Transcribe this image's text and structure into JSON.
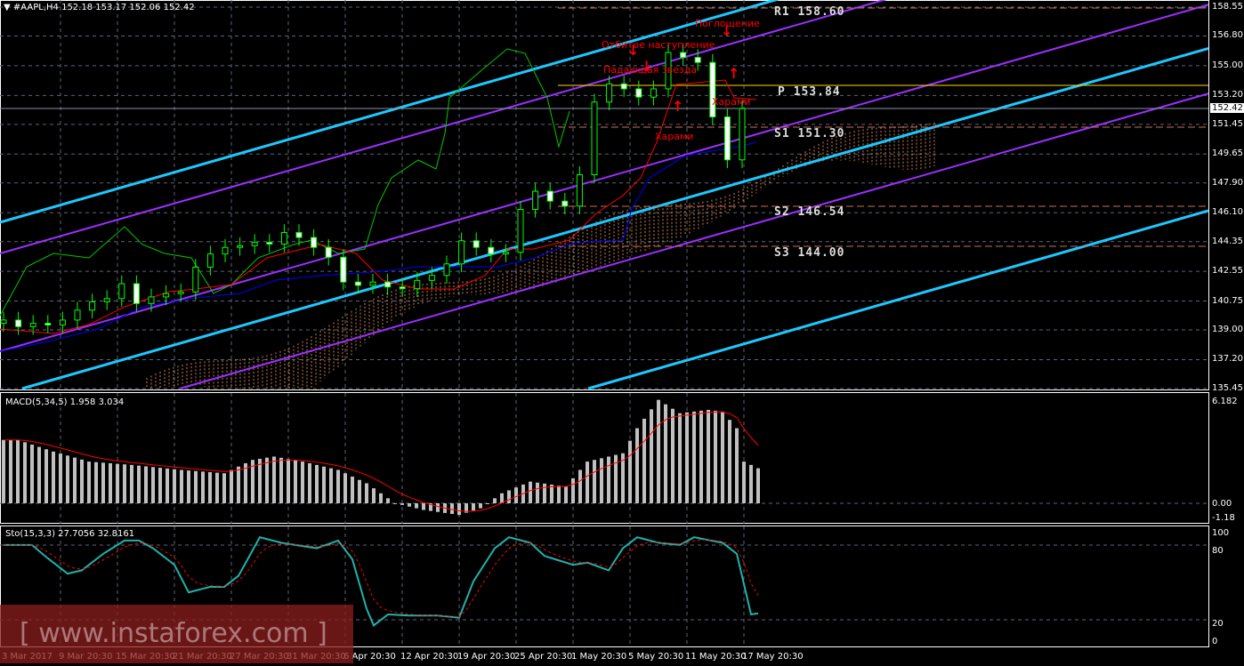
{
  "header": {
    "symbol": "#AAPL,H4",
    "ohlc": "152.18 153.17 152.06 152.42"
  },
  "colors": {
    "bull": "#00ff00",
    "channel_cyan": "#1ec8ff",
    "channel_purple": "#9b30ff",
    "pivot": "#ffd700",
    "tenkan": "#ff0000",
    "kijun": "#0000ff",
    "chikou": "#00c800",
    "cloud": "#ffa060"
  },
  "pivots": {
    "r1": "R1 158.60",
    "p": "P 153.84",
    "s1": "S1 151.30",
    "s2": "S2 146.54",
    "s3": "S3 144.00"
  },
  "annotations": {
    "engulfing": "Поглощение",
    "repelled": "Отбитое наступление",
    "shooting_star": "Падающая звезда",
    "harami1": "Харами",
    "harami2": "Харами"
  },
  "price_axis": [
    "158.55",
    "156.80",
    "155.00",
    "153.20",
    "151.45",
    "149.65",
    "147.90",
    "146.10",
    "144.35",
    "142.55",
    "140.75",
    "139.00",
    "137.20",
    "135.45"
  ],
  "current_price": "152.42",
  "macd": {
    "label": "MACD(5,34,5) 1.958 3.034",
    "axis": [
      "6.182",
      "0.00",
      "-1.18"
    ]
  },
  "sto": {
    "label": "Sto(15,3,3) 27.7056 32.8161",
    "axis": [
      "100",
      "80",
      "20",
      "0"
    ]
  },
  "dates": [
    "3 Mar 2017",
    "9 Mar 20:30",
    "15 Mar 20:30",
    "21 Mar 20:30",
    "27 Mar 20:30",
    "31 Mar 20:30",
    "6 Apr 20:30",
    "12 Apr 20:30",
    "19 Apr 20:30",
    "25 Apr 20:30",
    "1 May 20:30",
    "5 May 20:30",
    "11 May 20:30",
    "17 May 20:30"
  ],
  "watermark": "[ www.instaforex.com ]",
  "chart_data": [
    {
      "type": "candlestick",
      "title": "#AAPL,H4",
      "ylim": [
        135.45,
        158.55
      ],
      "closes": [
        139.6,
        139.2,
        139.4,
        139.3,
        139.6,
        140.2,
        140.7,
        140.9,
        141.8,
        140.6,
        141.0,
        141.2,
        141.3,
        142.8,
        143.6,
        144.0,
        144.1,
        144.3,
        144.2,
        144.9,
        144.6,
        144.0,
        143.4,
        141.9,
        141.7,
        141.9,
        141.6,
        141.5,
        142.0,
        142.3,
        143.0,
        144.4,
        144.0,
        143.6,
        143.7,
        146.3,
        147.4,
        146.8,
        146.5,
        148.4,
        152.8,
        153.9,
        153.6,
        153.1,
        153.6,
        155.8,
        155.5,
        155.2,
        151.9,
        149.3,
        152.4
      ]
    },
    {
      "type": "bar",
      "title": "MACD(5,34,5)",
      "ylim": [
        -1.18,
        6.182
      ],
      "keypoints": [
        [
          0,
          3.8
        ],
        [
          2,
          3.8
        ],
        [
          7,
          3.1
        ],
        [
          12,
          2.5
        ],
        [
          18,
          2.3
        ],
        [
          25,
          2.0
        ],
        [
          31,
          1.8
        ],
        [
          35,
          2.6
        ],
        [
          38,
          2.8
        ],
        [
          42,
          2.5
        ],
        [
          47,
          2.0
        ],
        [
          51,
          1.2
        ],
        [
          55,
          0
        ],
        [
          59,
          -0.4
        ],
        [
          64,
          -0.7
        ],
        [
          67,
          -0.3
        ],
        [
          70,
          0.6
        ],
        [
          74,
          1.3
        ],
        [
          79,
          1.0
        ],
        [
          82,
          2.5
        ],
        [
          87,
          3.0
        ],
        [
          89,
          4.5
        ],
        [
          92,
          6.2
        ],
        [
          95,
          5.4
        ],
        [
          99,
          5.6
        ],
        [
          101,
          5.5
        ],
        [
          103,
          4.5
        ],
        [
          104,
          2.5
        ],
        [
          106,
          2.1
        ]
      ]
    },
    {
      "type": "line",
      "title": "Sto(15,3,3)",
      "ylim": [
        0,
        100
      ],
      "keypoints": [
        [
          0,
          88
        ],
        [
          4,
          88
        ],
        [
          6,
          77
        ],
        [
          9,
          62
        ],
        [
          11,
          65
        ],
        [
          14,
          80
        ],
        [
          17,
          92
        ],
        [
          19,
          92
        ],
        [
          21,
          85
        ],
        [
          24,
          70
        ],
        [
          26,
          45
        ],
        [
          29,
          50
        ],
        [
          31,
          50
        ],
        [
          33,
          60
        ],
        [
          36,
          95
        ],
        [
          39,
          90
        ],
        [
          41,
          88
        ],
        [
          44,
          85
        ],
        [
          47,
          92
        ],
        [
          49,
          75
        ],
        [
          51,
          30
        ],
        [
          52,
          15
        ],
        [
          54,
          25
        ],
        [
          57,
          24
        ],
        [
          61,
          24
        ],
        [
          64,
          22
        ],
        [
          66,
          55
        ],
        [
          69,
          85
        ],
        [
          71,
          95
        ],
        [
          74,
          90
        ],
        [
          76,
          78
        ],
        [
          80,
          70
        ],
        [
          82,
          72
        ],
        [
          85,
          65
        ],
        [
          87,
          85
        ],
        [
          89,
          95
        ],
        [
          92,
          90
        ],
        [
          95,
          88
        ],
        [
          97,
          95
        ],
        [
          101,
          90
        ],
        [
          103,
          80
        ],
        [
          105,
          25
        ],
        [
          106,
          26
        ]
      ]
    }
  ]
}
